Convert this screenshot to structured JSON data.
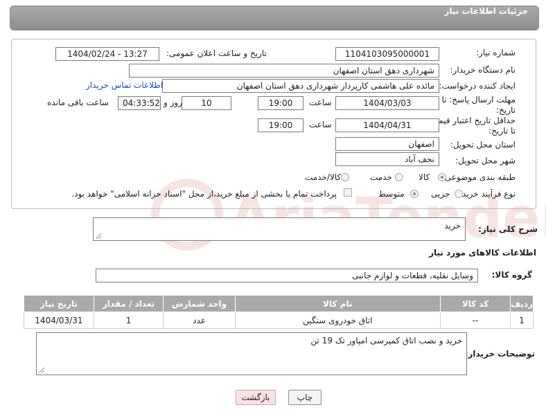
{
  "header": {
    "title": "جزئیات اطلاعات نیاز"
  },
  "form": {
    "need_number_label": "شماره نیاز:",
    "need_number": "1104103095000001",
    "announce_datetime_label": "تاریخ و ساعت اعلان عمومی:",
    "announce_datetime": "1404/02/24 - 13:27",
    "buyer_org_label": "نام دستگاه خریدار:",
    "buyer_org": "شهرداری دهق استان اصفهان",
    "requester_label": "ایجاد کننده درخواست:",
    "requester": "مائده علی هاشمی کارپرداز شهرداری دهق استان اصفهان",
    "buyer_contact_link": "اطلاعات تماس خریدار",
    "reply_deadline_label": "مهلت ارسال پاسخ: تا تاریخ:",
    "reply_deadline_date": "1404/03/03",
    "time_label": "ساعت",
    "reply_deadline_time": "19:00",
    "days_value": "10",
    "days_and_label": "روز و",
    "remaining_time": "04:33:52",
    "remaining_label": "ساعت باقی مانده",
    "price_validity_label": "حداقل تاریخ اعتبار قیمت: تا تاریخ:",
    "price_validity_date": "1404/04/31",
    "price_validity_time": "19:00",
    "delivery_province_label": "استان محل تحویل:",
    "delivery_province": "اصفهان",
    "delivery_city_label": "شهر محل تحویل:",
    "delivery_city": "نجف آباد",
    "category_label": "طبقه بندی موضوعی:",
    "category_options": [
      "کالا",
      "خدمت",
      "کالا/خدمت"
    ],
    "purchase_type_label": "نوع فرآیند خرید :",
    "purchase_type_options": [
      "جزیی",
      "متوسط"
    ],
    "payment_note": "پرداخت تمام یا بخشی از مبلغ خرید،از محل \"اسناد خزانه اسلامی\" خواهد بود."
  },
  "description": {
    "label": "شرح کلی نیاز:",
    "value": "خرید"
  },
  "goods_section": {
    "title": "اطلاعات کالاهای مورد نیاز",
    "group_label": "گروه کالا:",
    "group_value": "وسایل نقلیه، قطعات و لوازم جانبی"
  },
  "table": {
    "headers": [
      "ردیف",
      "کد کالا",
      "نام کالا",
      "واحد شمارش",
      "تعداد / مقدار",
      "تاریخ نیاز"
    ],
    "rows": [
      [
        "1",
        "--",
        "اتاق خودروی سنگین",
        "عدد",
        "1",
        "1404/03/31"
      ]
    ]
  },
  "buyer_notes": {
    "label": "توضیحات خریدار:",
    "value": "خرید و نصب اتاق کمپرسی امپاور تک 19 تن"
  },
  "buttons": {
    "print": "چاپ",
    "back": "بازگشت"
  },
  "watermark": {
    "text": "AriaTender.net"
  }
}
